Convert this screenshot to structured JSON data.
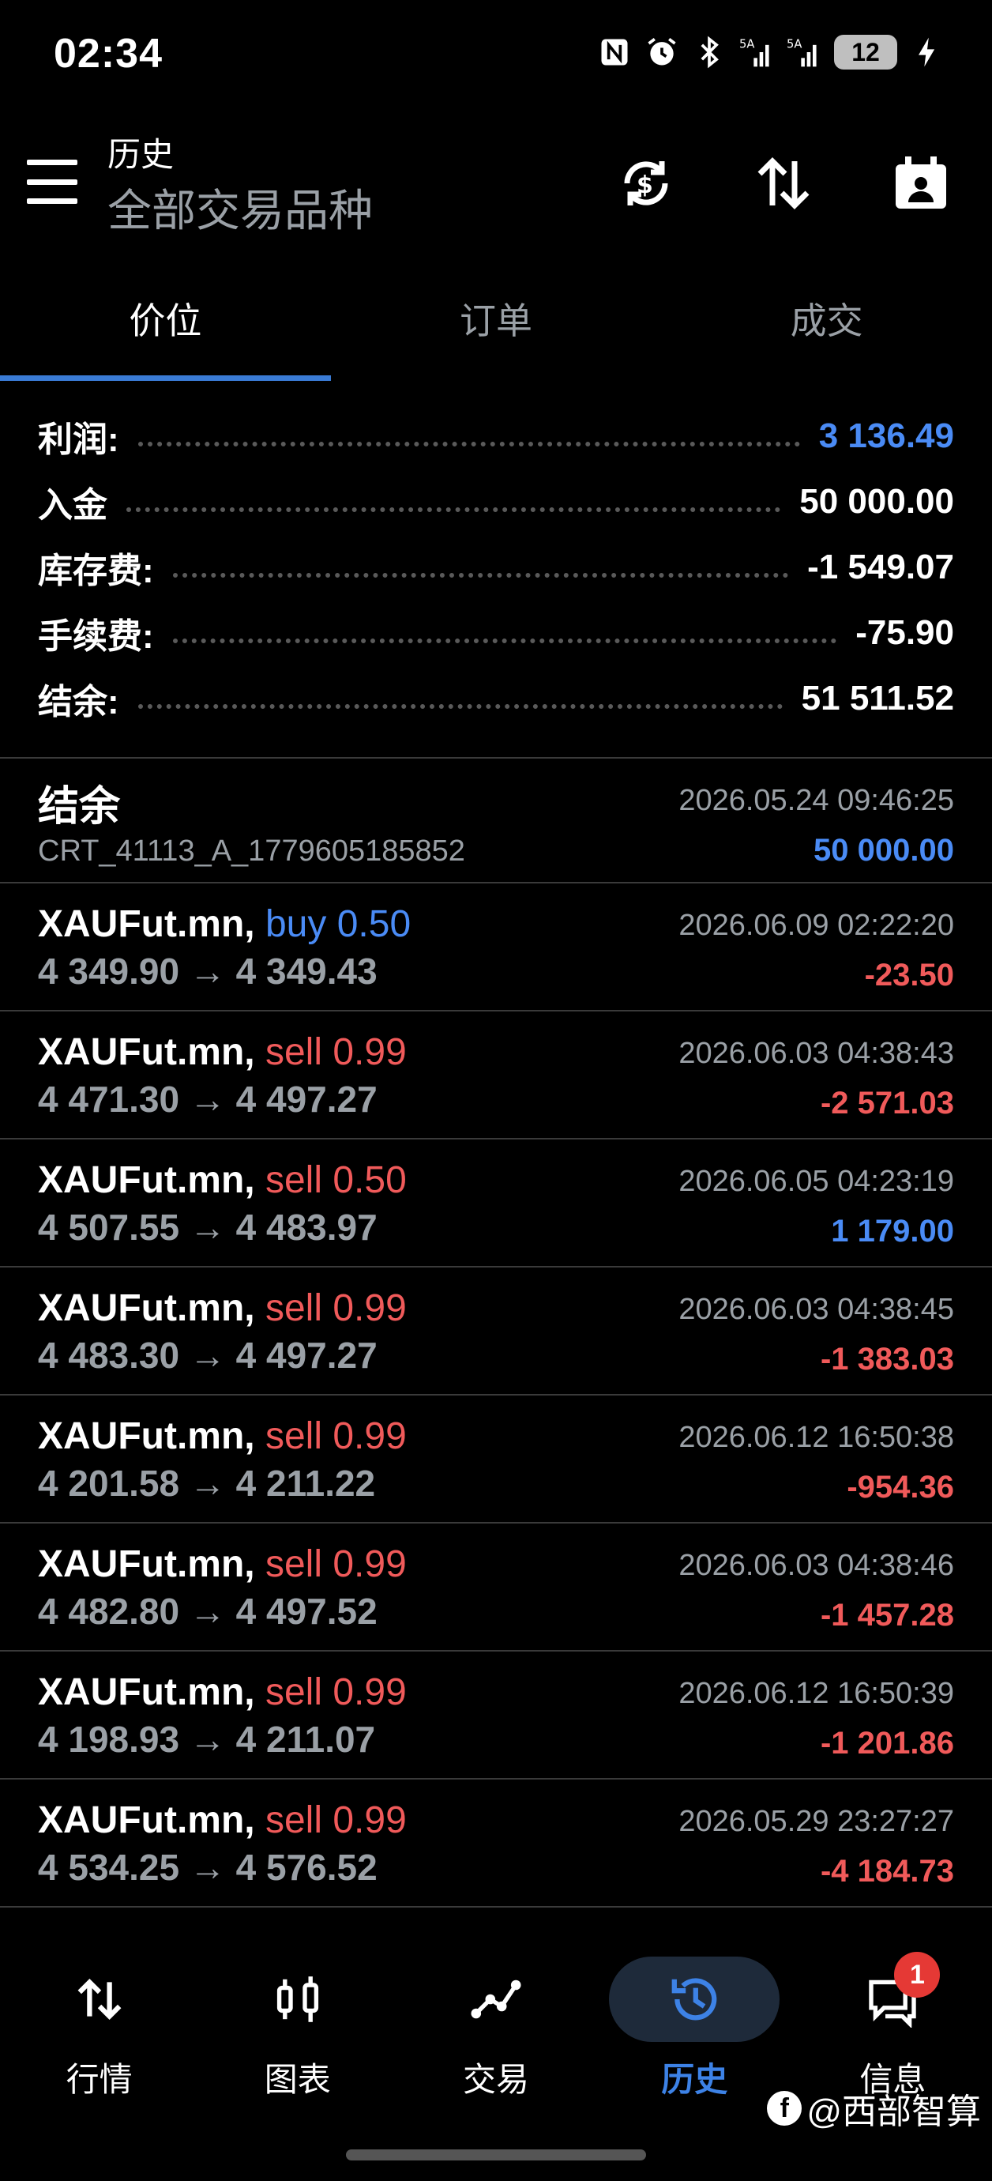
{
  "status_bar": {
    "time": "02:34",
    "icons": [
      "nfc-icon",
      "alarm-icon",
      "bluetooth-icon",
      "signal-5g-icon",
      "signal-5g-icon"
    ],
    "battery": "12"
  },
  "app_bar": {
    "title": "历史",
    "subtitle": "全部交易品种",
    "actions": [
      "sync-currency-icon",
      "sort-icon",
      "calendar-icon"
    ]
  },
  "tabs": [
    {
      "label": "价位",
      "active": true
    },
    {
      "label": "订单",
      "active": false
    },
    {
      "label": "成交",
      "active": false
    }
  ],
  "summary": [
    {
      "label": "利润:",
      "value": "3 136.49",
      "color": "#4a8bf5"
    },
    {
      "label": "入金",
      "value": "50 000.00",
      "color": "#ffffff"
    },
    {
      "label": "库存费:",
      "value": "-1 549.07",
      "color": "#ffffff"
    },
    {
      "label": "手续费:",
      "value": "-75.90",
      "color": "#ffffff"
    },
    {
      "label": "结余:",
      "value": "51 511.52",
      "color": "#ffffff"
    }
  ],
  "balance_entry": {
    "title": "结余",
    "id": "CRT_41113_A_1779605185852",
    "time": "2026.05.24 09:46:25",
    "amount": "50 000.00"
  },
  "deals": [
    {
      "symbol": "XAUFut.mn,",
      "side": "buy 0.50",
      "prices": "4 349.90 → 4 349.43",
      "time": "2026.06.09 02:22:20",
      "profit": "-23.50"
    },
    {
      "symbol": "XAUFut.mn,",
      "side": "sell 0.99",
      "prices": "4 471.30 → 4 497.27",
      "time": "2026.06.03 04:38:43",
      "profit": "-2 571.03"
    },
    {
      "symbol": "XAUFut.mn,",
      "side": "sell 0.50",
      "prices": "4 507.55 → 4 483.97",
      "time": "2026.06.05 04:23:19",
      "profit": "1 179.00"
    },
    {
      "symbol": "XAUFut.mn,",
      "side": "sell 0.99",
      "prices": "4 483.30 → 4 497.27",
      "time": "2026.06.03 04:38:45",
      "profit": "-1 383.03"
    },
    {
      "symbol": "XAUFut.mn,",
      "side": "sell 0.99",
      "prices": "4 201.58 → 4 211.22",
      "time": "2026.06.12 16:50:38",
      "profit": "-954.36"
    },
    {
      "symbol": "XAUFut.mn,",
      "side": "sell 0.99",
      "prices": "4 482.80 → 4 497.52",
      "time": "2026.06.03 04:38:46",
      "profit": "-1 457.28"
    },
    {
      "symbol": "XAUFut.mn,",
      "side": "sell 0.99",
      "prices": "4 198.93 → 4 211.07",
      "time": "2026.06.12 16:50:39",
      "profit": "-1 201.86"
    },
    {
      "symbol": "XAUFut.mn,",
      "side": "sell 0.99",
      "prices": "4 534.25 → 4 576.52",
      "time": "2026.05.29 23:27:27",
      "profit": "-4 184.73"
    }
  ],
  "colors": {
    "buy": "#4a8bf5",
    "sell": "#f05a5a",
    "positive": "#4a8bf5",
    "negative": "#f05a5a",
    "accent": "#3a7bd5"
  },
  "bottom_nav": [
    {
      "label": "行情",
      "icon": "quotes-arrows-icon",
      "active": false
    },
    {
      "label": "图表",
      "icon": "candlestick-icon",
      "active": false
    },
    {
      "label": "交易",
      "icon": "trade-line-icon",
      "active": false
    },
    {
      "label": "历史",
      "icon": "history-clock-icon",
      "active": true
    },
    {
      "label": "信息",
      "icon": "messages-icon",
      "active": false,
      "badge": "1"
    }
  ],
  "watermark": {
    "logo": "f",
    "text": "@西部智算"
  }
}
